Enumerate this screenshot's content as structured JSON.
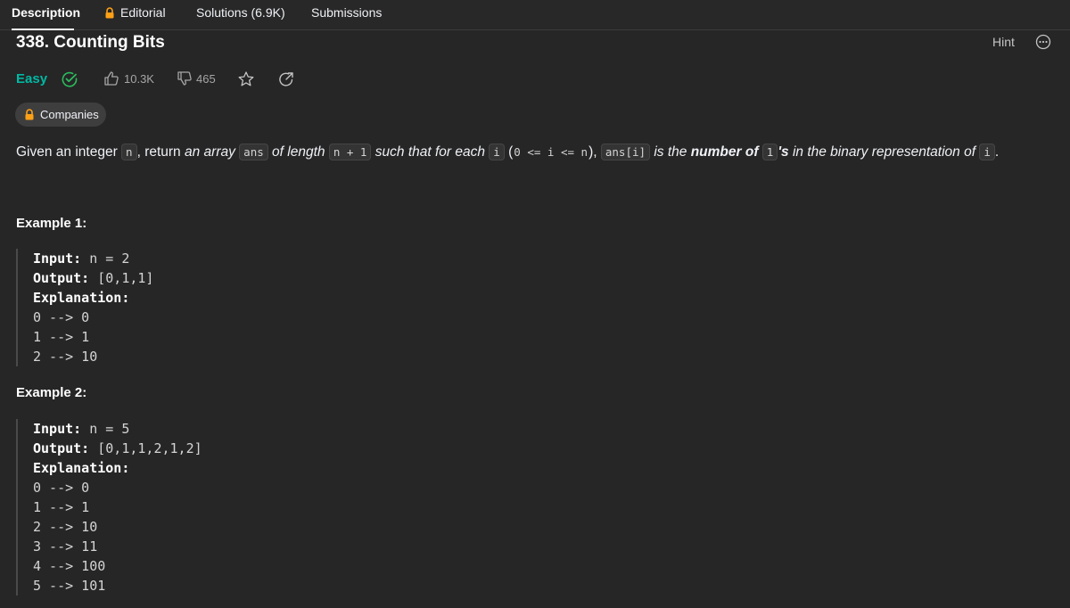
{
  "tabs": [
    {
      "label": "Description",
      "active": true
    },
    {
      "label": "Editorial",
      "locked": true
    },
    {
      "label": "Solutions (6.9K)"
    },
    {
      "label": "Submissions"
    }
  ],
  "problem": {
    "title": "338. Counting Bits",
    "hint_label": "Hint",
    "difficulty": "Easy",
    "likes": "10.3K",
    "dislikes": "465",
    "companies_label": "Companies"
  },
  "description": {
    "t1": "Given an integer ",
    "c1": "n",
    "t2": ", return ",
    "i1": "an array ",
    "c2": "ans",
    "i2": " of length ",
    "c3": "n + 1",
    "i3": " such that for each ",
    "c4": "i",
    "t3": " (",
    "c5": "0 <= i <= n",
    "t4": "), ",
    "c6": "ans[i]",
    "i4": " is the ",
    "b1": "number of ",
    "c7": "1",
    "b2": "'s",
    "i5": " in the binary representation of ",
    "c8": "i",
    "t5": "."
  },
  "examples": [
    {
      "title": "Example 1:",
      "input_label": "Input:",
      "input_value": "n = 2",
      "output_label": "Output:",
      "output_value": "[0,1,1]",
      "explanation_label": "Explanation:",
      "lines": [
        "0 --> 0",
        "1 --> 1",
        "2 --> 10"
      ]
    },
    {
      "title": "Example 2:",
      "input_label": "Input:",
      "input_value": "n = 5",
      "output_label": "Output:",
      "output_value": "[0,1,1,2,1,2]",
      "explanation_label": "Explanation:",
      "lines": [
        "0 --> 0",
        "1 --> 1",
        "2 --> 10",
        "3 --> 11",
        "4 --> 100",
        "5 --> 101"
      ]
    }
  ],
  "colors": {
    "background": "#262626",
    "easy": "#00b8a3",
    "lock": "#ffa116"
  }
}
